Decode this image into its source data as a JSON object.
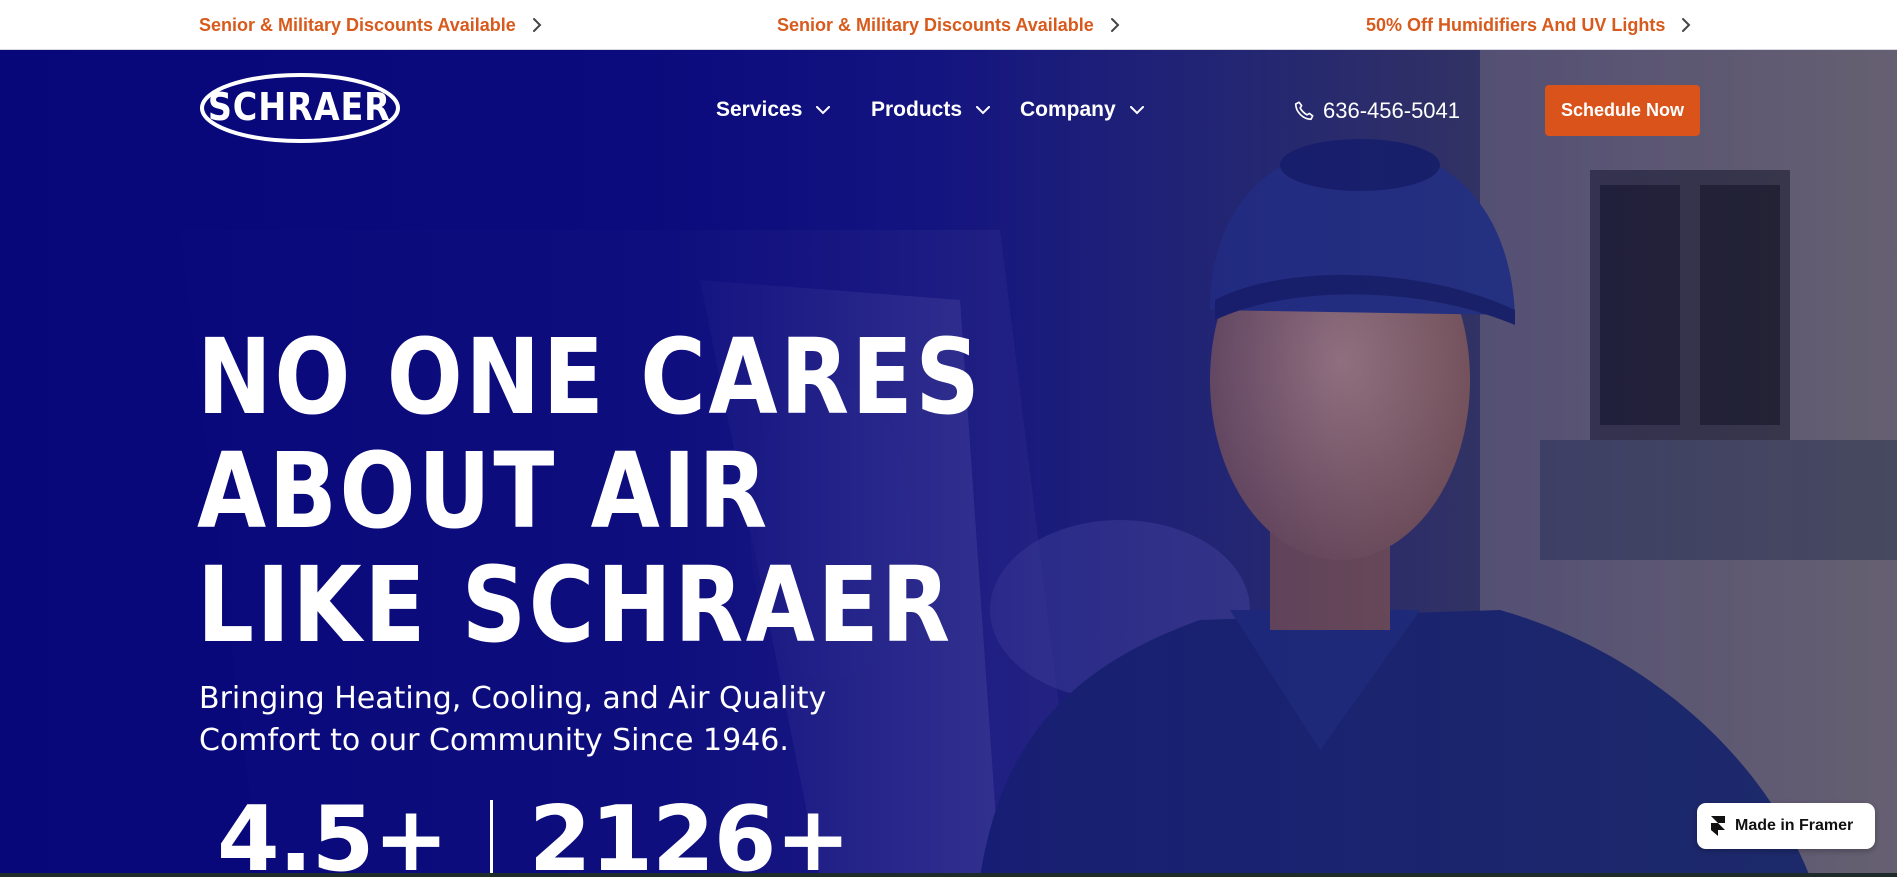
{
  "announcements": [
    {
      "label": "Senior & Military Discounts Available"
    },
    {
      "label": "Senior & Military Discounts Available"
    },
    {
      "label": "50% Off Humidifiers And UV Lights"
    }
  ],
  "header": {
    "logo_text": "SCHRAER",
    "nav": [
      {
        "label": "Services"
      },
      {
        "label": "Products"
      },
      {
        "label": "Company"
      }
    ],
    "phone": "636-456-5041",
    "cta_label": "Schedule Now"
  },
  "hero": {
    "headline": [
      "NO ONE CARES",
      "ABOUT AIR",
      "LIKE SCHRAER"
    ],
    "subhead_line1": "Bringing Heating, Cooling, and Air Quality",
    "subhead_line2": "Comfort to our Community Since 1946.",
    "stats": [
      "4.5+",
      "2126+"
    ]
  },
  "badge": {
    "label": "Made in Framer"
  },
  "colors": {
    "accent": "#d9531a",
    "announce_text": "#d85a1c",
    "hero_blue": "#0a0a7a",
    "white": "#ffffff"
  },
  "icons": {
    "announce_chevron": "chevron-right-icon",
    "nav_chevron": "chevron-down-icon",
    "phone": "phone-icon",
    "framer": "framer-icon"
  }
}
